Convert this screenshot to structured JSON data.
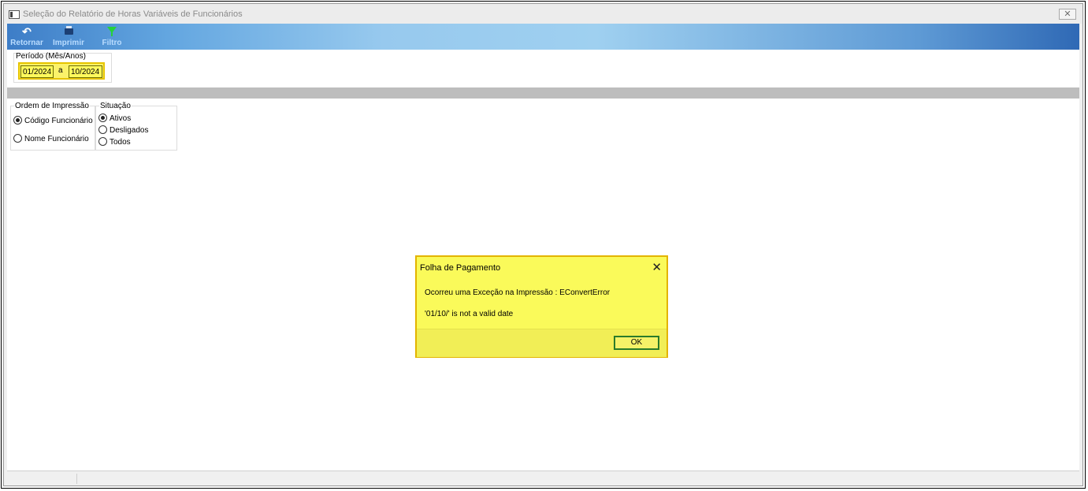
{
  "window": {
    "title": "Seleção do Relatório de Horas Variáveis de Funcionários",
    "close_glyph": "✕"
  },
  "toolbar": {
    "buttons": [
      {
        "label": "Retornar",
        "icon": "undo-icon"
      },
      {
        "label": "Imprimir",
        "icon": "printer-icon"
      },
      {
        "label": "Filtro",
        "icon": "filter-icon"
      }
    ]
  },
  "periodo": {
    "label": "Período (Mês/Anos)",
    "from": "01/2024",
    "separator": "a",
    "to": "10/2024"
  },
  "ordem": {
    "label": "Ordem de Impressão",
    "options": [
      {
        "label": "Código Funcionário",
        "checked": true
      },
      {
        "label": "Nome Funcionário",
        "checked": false
      }
    ]
  },
  "situacao": {
    "label": "Situação",
    "options": [
      {
        "label": "Ativos",
        "checked": true
      },
      {
        "label": "Desligados",
        "checked": false
      },
      {
        "label": "Todos",
        "checked": false
      }
    ]
  },
  "dialog": {
    "title": "Folha de Pagamento",
    "close_glyph": "✕",
    "message_line1": "Ocorreu uma Exceção na Impressão : EConvertError",
    "message_line2": "'01/10/' is not a valid date",
    "ok_label": "OK"
  },
  "colors": {
    "highlight": "#fafa5a",
    "toolbar_start": "#3d7dc7",
    "toolbar_end": "#2f69b5"
  }
}
